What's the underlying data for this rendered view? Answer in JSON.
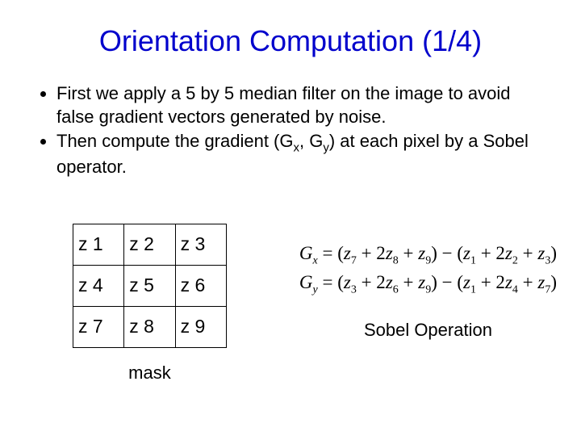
{
  "title": "Orientation Computation (1/4)",
  "bullets": {
    "b1_pre": "First we apply a 5 by 5 median filter on the image to avoid false gradient vectors generated by noise.",
    "b2_pre": "Then compute the gradient (G",
    "b2_gx_sub": "x",
    "b2_mid": ", G",
    "b2_gy_sub": "y",
    "b2_post": ") at each pixel by a Sobel operator."
  },
  "mask": {
    "rows": [
      {
        "c": [
          "z 1",
          "z 2",
          "z 3"
        ]
      },
      {
        "c": [
          "z 4",
          "z 5",
          "z 6"
        ]
      },
      {
        "c": [
          "z 7",
          "z 8",
          "z 9"
        ]
      }
    ],
    "label": "mask"
  },
  "formulas": {
    "gx": {
      "lhs": "G",
      "lhs_sub": "x",
      "eq": " = (",
      "t1": "z",
      "t1s": "7",
      "p1": " + 2",
      "t2": "z",
      "t2s": "8",
      "p2": " + ",
      "t3": "z",
      "t3s": "9",
      "mid": ") − (",
      "t4": "z",
      "t4s": "1",
      "p3": " + 2",
      "t5": "z",
      "t5s": "2",
      "p4": " + ",
      "t6": "z",
      "t6s": "3",
      "end": ")"
    },
    "gy": {
      "lhs": "G",
      "lhs_sub": "y",
      "eq": " = (",
      "t1": "z",
      "t1s": "3",
      "p1": " + 2",
      "t2": "z",
      "t2s": "6",
      "p2": " + ",
      "t3": "z",
      "t3s": "9",
      "mid": ") − (",
      "t4": "z",
      "t4s": "1",
      "p3": " + 2",
      "t5": "z",
      "t5s": "4",
      "p4": " + ",
      "t6": "z",
      "t6s": "7",
      "end": ")"
    },
    "label": "Sobel Operation"
  }
}
